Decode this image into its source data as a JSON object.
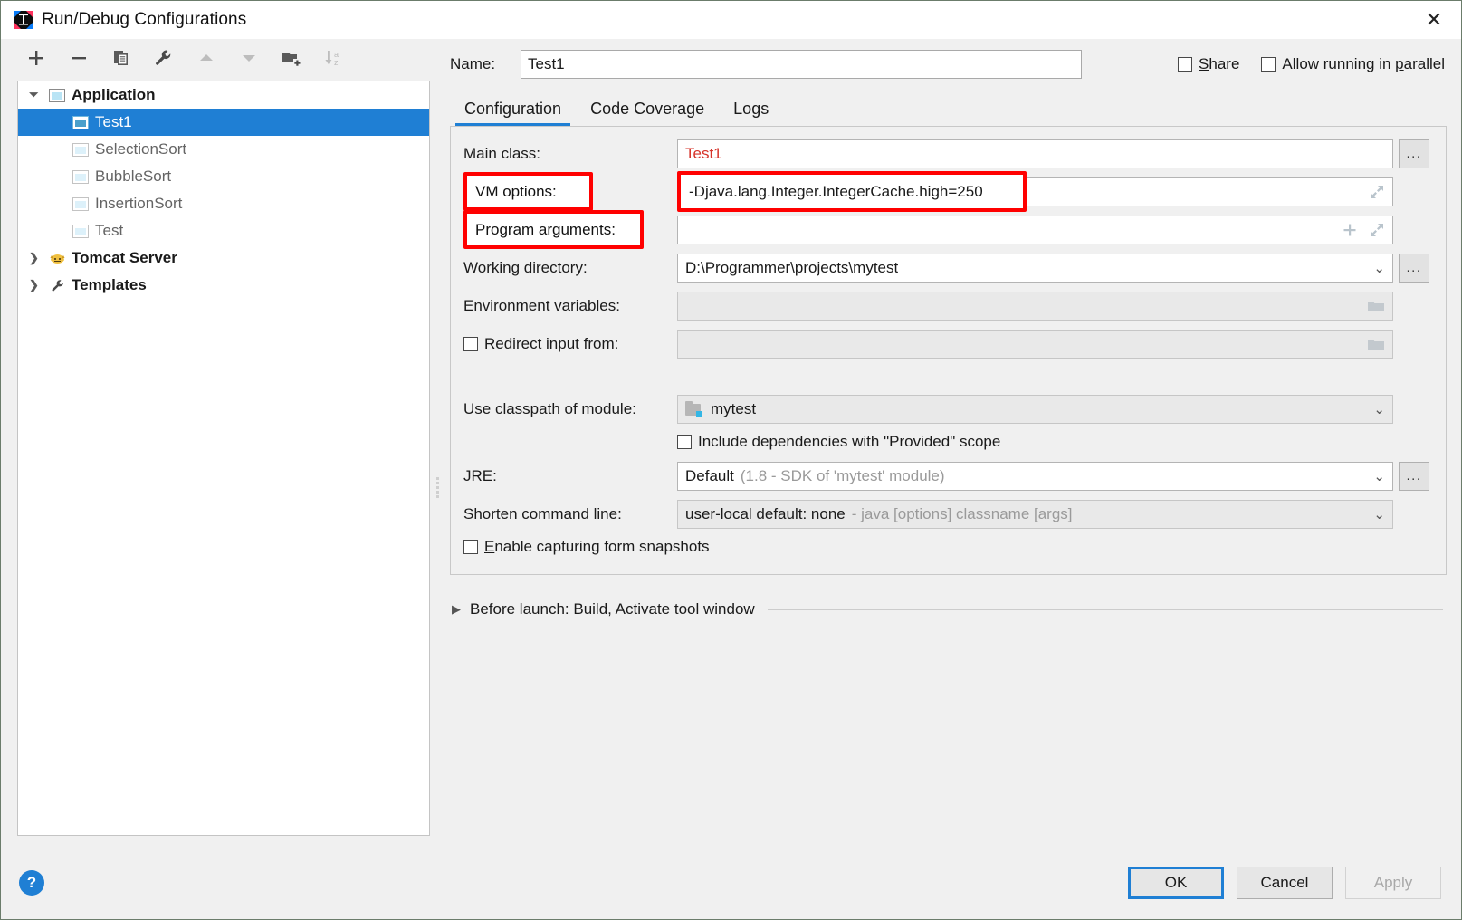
{
  "window": {
    "title": "Run/Debug Configurations",
    "app_icon": "intellij-idea-icon",
    "close_icon": "✕"
  },
  "toolbar": {
    "items": [
      {
        "name": "add-configuration-button",
        "icon": "plus-icon",
        "enabled": true
      },
      {
        "name": "remove-configuration-button",
        "icon": "minus-icon",
        "enabled": true
      },
      {
        "name": "copy-configuration-button",
        "icon": "copy-icon",
        "enabled": true
      },
      {
        "name": "edit-templates-button",
        "icon": "wrench-icon",
        "enabled": true
      },
      {
        "name": "move-up-button",
        "icon": "arrow-up-icon",
        "enabled": false
      },
      {
        "name": "move-down-button",
        "icon": "arrow-down-icon",
        "enabled": false
      },
      {
        "name": "create-folder-button",
        "icon": "folder-add-icon",
        "enabled": true
      },
      {
        "name": "sort-alphabetically-button",
        "icon": "sort-az-icon",
        "enabled": false
      }
    ]
  },
  "tree": {
    "nodes": [
      {
        "label": "Application",
        "type": "root",
        "expanded": true,
        "icon": "application-icon"
      },
      {
        "label": "Test1",
        "type": "child",
        "selected": true,
        "icon": "application-icon"
      },
      {
        "label": "SelectionSort",
        "type": "child",
        "selected": false,
        "icon": "application-icon"
      },
      {
        "label": "BubbleSort",
        "type": "child",
        "selected": false,
        "icon": "application-icon"
      },
      {
        "label": "InsertionSort",
        "type": "child",
        "selected": false,
        "icon": "application-icon"
      },
      {
        "label": "Test",
        "type": "child",
        "selected": false,
        "icon": "application-icon"
      },
      {
        "label": "Tomcat Server",
        "type": "root",
        "expanded": false,
        "icon": "tomcat-cat-icon"
      },
      {
        "label": "Templates",
        "type": "root",
        "expanded": false,
        "icon": "wrench-icon"
      }
    ]
  },
  "header": {
    "name_label": "Name:",
    "name_value": "Test1",
    "share": {
      "label_pre": "",
      "mnemonic": "S",
      "label_post": "hare",
      "checked": false
    },
    "parallel": {
      "label_pre": "Allow running in ",
      "mnemonic": "p",
      "label_post": "arallel",
      "checked": false
    }
  },
  "tabs": [
    {
      "label": "Configuration",
      "active": true
    },
    {
      "label": "Code Coverage",
      "active": false
    },
    {
      "label": "Logs",
      "active": false
    }
  ],
  "form": {
    "main_class": {
      "label": "Main class:",
      "value": "Test1",
      "browse": "...",
      "value_color": "#d6332a"
    },
    "vm_options": {
      "label": "VM options:",
      "value": "-Djava.lang.Integer.IntegerCache.high=250",
      "expand_icon": "expand-icon",
      "highlighted": true
    },
    "program_arguments": {
      "label": "Program arguments:",
      "value": "",
      "add_icon": "plus-icon",
      "expand_icon": "expand-icon",
      "highlighted": true
    },
    "working_directory": {
      "label": "Working directory:",
      "value": "D:\\Programmer\\projects\\mytest",
      "dropdown_icon": "chevron-down-icon",
      "browse": "..."
    },
    "environment_variables": {
      "label": "Environment variables:",
      "value": "",
      "folder_icon": "folder-icon",
      "disabled": true
    },
    "redirect_input": {
      "label": "Redirect input from:",
      "value": "",
      "checked": false,
      "folder_icon": "folder-icon",
      "disabled": true
    },
    "classpath_module": {
      "label": "Use classpath of module:",
      "value": "mytest",
      "module_icon": "module-icon",
      "dropdown_icon": "chevron-down-icon",
      "disabled": true
    },
    "include_provided": {
      "label": "Include dependencies with \"Provided\" scope",
      "checked": false
    },
    "jre": {
      "label": "JRE:",
      "value": "Default",
      "hint": "(1.8 - SDK of 'mytest' module)",
      "dropdown_icon": "chevron-down-icon",
      "browse": "..."
    },
    "shorten_command_line": {
      "label": "Shorten command line:",
      "value": "user-local default: none",
      "hint": "- java [options] classname [args]",
      "dropdown_icon": "chevron-down-icon",
      "disabled": true
    },
    "form_snapshots": {
      "label_pre": "",
      "mnemonic": "E",
      "label_post": "nable capturing form snapshots",
      "checked": false
    }
  },
  "before_launch": {
    "triangle_icon": "triangle-right-icon",
    "label": "Before launch: Build, Activate tool window"
  },
  "footer": {
    "help_label": "?",
    "ok": "OK",
    "cancel": "Cancel",
    "apply": "Apply"
  },
  "colors": {
    "accent": "#1f7fd4",
    "selection": "#1f7fd4",
    "annotation": "#ff0000",
    "error_text": "#d6332a",
    "hint_text": "#9a9a9a"
  }
}
